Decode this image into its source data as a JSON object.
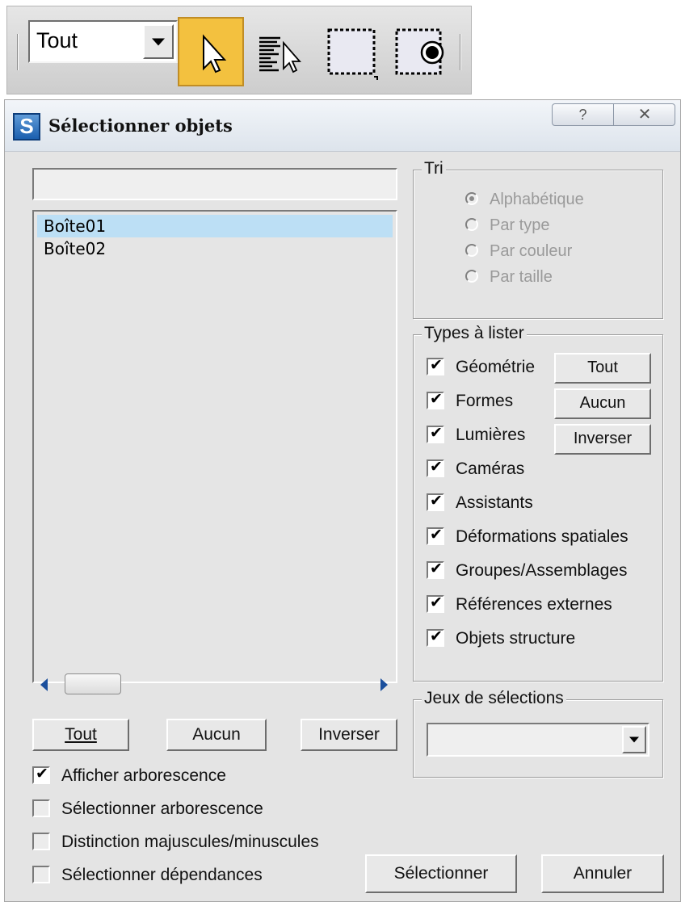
{
  "toolbar": {
    "filter_value": "Tout",
    "tools": [
      {
        "name": "select-object",
        "active": true
      },
      {
        "name": "select-by-name",
        "active": false
      },
      {
        "name": "rectangular-selection-region",
        "active": false
      },
      {
        "name": "window-crossing",
        "active": false
      }
    ],
    "active_color": "#f3c13f"
  },
  "dialog": {
    "title": "Sélectionner objets",
    "help_glyph": "?",
    "close_glyph": "✕",
    "icon_letter": "S",
    "search": {
      "value": "",
      "placeholder": ""
    },
    "objects": [
      {
        "label": "Boîte01",
        "selected": true
      },
      {
        "label": "Boîte02",
        "selected": false
      }
    ],
    "list_buttons": {
      "all": "Tout",
      "none": "Aucun",
      "invert": "Inverser"
    },
    "options": [
      {
        "label": "Afficher arborescence",
        "checked": true
      },
      {
        "label": "Sélectionner arborescence",
        "checked": false
      },
      {
        "label": "Distinction majuscules/minuscules",
        "checked": false
      },
      {
        "label": "Sélectionner dépendances",
        "checked": false
      }
    ],
    "sort": {
      "title": "Tri",
      "options": [
        {
          "label": "Alphabétique",
          "selected": true
        },
        {
          "label": "Par type",
          "selected": false
        },
        {
          "label": "Par couleur",
          "selected": false
        },
        {
          "label": "Par taille",
          "selected": false
        }
      ]
    },
    "types": {
      "title": "Types à lister",
      "items": [
        {
          "label": "Géométrie",
          "checked": true
        },
        {
          "label": "Formes",
          "checked": true
        },
        {
          "label": "Lumières",
          "checked": true
        },
        {
          "label": "Caméras",
          "checked": true
        },
        {
          "label": "Assistants",
          "checked": true
        },
        {
          "label": "Déformations spatiales",
          "checked": true
        },
        {
          "label": "Groupes/Assemblages",
          "checked": true
        },
        {
          "label": "Références externes",
          "checked": true
        },
        {
          "label": "Objets structure",
          "checked": true
        }
      ],
      "buttons": {
        "all": "Tout",
        "none": "Aucun",
        "invert": "Inverser"
      }
    },
    "selection_sets": {
      "title": "Jeux de sélections",
      "value": ""
    },
    "actions": {
      "select": "Sélectionner",
      "cancel": "Annuler"
    }
  },
  "colors": {
    "dialog_bg": "#e4e4e4",
    "list_selected": "#bcdff5",
    "scroll_arrow": "#1b4f9c",
    "disabled_text": "#9a9a9a"
  }
}
